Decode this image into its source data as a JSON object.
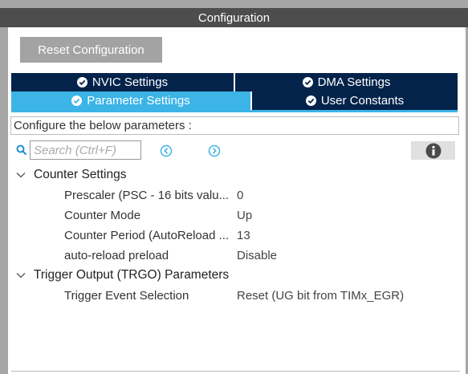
{
  "window": {
    "title": "Configuration"
  },
  "toolbar": {
    "reset_label": "Reset Configuration"
  },
  "tabs": [
    {
      "label": "NVIC Settings",
      "active": false
    },
    {
      "label": "DMA Settings",
      "active": false
    },
    {
      "label": "Parameter Settings",
      "active": true
    },
    {
      "label": "User Constants",
      "active": false
    }
  ],
  "description": "Configure the below parameters :",
  "search": {
    "placeholder": "Search (Ctrl+F)"
  },
  "groups": [
    {
      "label": "Counter Settings",
      "rows": [
        {
          "label": "Prescaler (PSC - 16 bits valu...",
          "value": "0"
        },
        {
          "label": "Counter Mode",
          "value": "Up"
        },
        {
          "label": "Counter Period (AutoReload ...",
          "value": "13"
        },
        {
          "label": "auto-reload preload",
          "value": "Disable"
        }
      ]
    },
    {
      "label": "Trigger Output (TRGO) Parameters",
      "rows": [
        {
          "label": "Trigger Event Selection",
          "value": "Reset (UG bit from TIMx_EGR)"
        }
      ]
    }
  ],
  "colors": {
    "tab_inactive": "#03234b",
    "tab_active": "#3cb4e6",
    "accent": "#3cb4e6",
    "title_bar": "#4d4d4d"
  },
  "icons": {
    "tab_check": "check-circle-icon",
    "search": "search-icon",
    "prev": "chevron-left-circle-icon",
    "next": "chevron-right-circle-icon",
    "info": "info-icon",
    "expand": "chevron-down-icon"
  }
}
